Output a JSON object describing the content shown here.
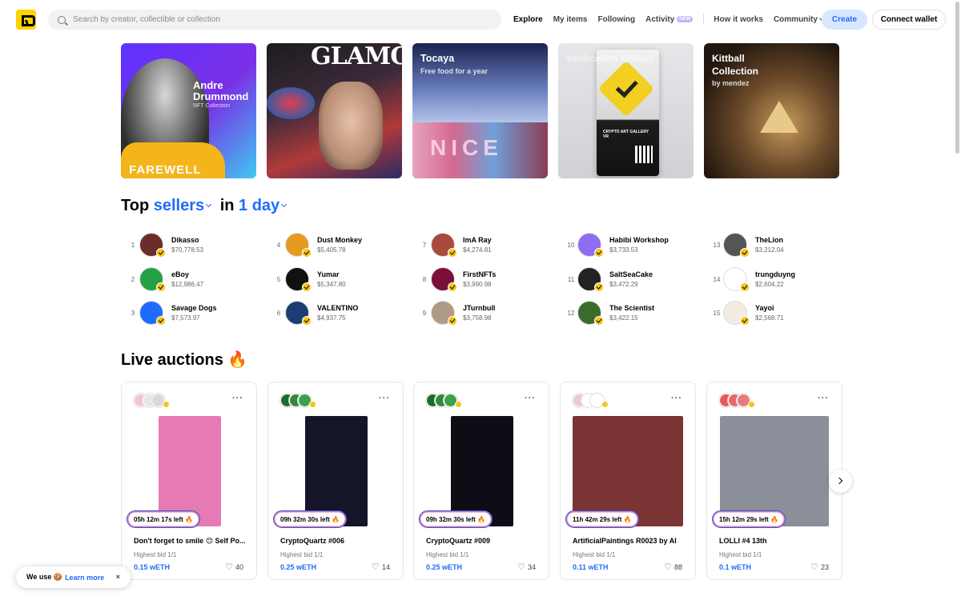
{
  "search": {
    "placeholder": "Search by creator, collectible or collection"
  },
  "nav": {
    "explore": "Explore",
    "my_items": "My items",
    "following": "Following",
    "activity": "Activity",
    "activity_badge": "NEW",
    "how_it_works": "How it works",
    "community": "Community"
  },
  "buttons": {
    "create": "Create",
    "connect_wallet": "Connect wallet"
  },
  "banners": [
    {
      "title_line1": "Andre",
      "title_line2": "Drummond",
      "subtitle": "NFT Collection",
      "text": "FAREWELL"
    },
    {
      "title": "GLAMOUR"
    },
    {
      "title": "Tocaya",
      "subtitle": "Free food for a year",
      "text": "NICE"
    },
    {
      "title": "Verification Collect",
      "text": "CRYPTO ART GALLERY VR"
    },
    {
      "title_line1": "Kittball",
      "title_line2": "Collection",
      "subtitle": "by mendez"
    }
  ],
  "top_sellers": {
    "title_prefix": "Top",
    "title_type": "sellers",
    "title_in": "in",
    "title_period": "1 day",
    "items": [
      {
        "rank": "1",
        "name": "Dikasso",
        "amount": "$70,778.53",
        "color": "#6b2c2c"
      },
      {
        "rank": "2",
        "name": "eBoy",
        "amount": "$12,986.47",
        "color": "#24a146"
      },
      {
        "rank": "3",
        "name": "Savage Dogs",
        "amount": "$7,573.97",
        "color": "#1f6bff"
      },
      {
        "rank": "4",
        "name": "Dust Monkey",
        "amount": "$5,405.78",
        "color": "#e79a22"
      },
      {
        "rank": "5",
        "name": "Yumar",
        "amount": "$5,347.80",
        "color": "#111111"
      },
      {
        "rank": "6",
        "name": "VALENTINO",
        "amount": "$4,937.75",
        "color": "#1b3d73"
      },
      {
        "rank": "7",
        "name": "ImA Ray",
        "amount": "$4,274.81",
        "color": "#a84a3c"
      },
      {
        "rank": "8",
        "name": "FirstNFTs",
        "amount": "$3,990.98",
        "color": "#7a0f3a"
      },
      {
        "rank": "9",
        "name": "JTurnbull",
        "amount": "$3,758.98",
        "color": "#b09a84"
      },
      {
        "rank": "10",
        "name": "Habibi Workshop",
        "amount": "$3,733.53",
        "color": "#8f6df2"
      },
      {
        "rank": "11",
        "name": "SaltSeaCake",
        "amount": "$3,472.29",
        "color": "#222222"
      },
      {
        "rank": "12",
        "name": "The Scientist",
        "amount": "$3,422.15",
        "color": "#3a6b2a"
      },
      {
        "rank": "13",
        "name": "TheLion",
        "amount": "$3,212.04",
        "color": "#555555"
      },
      {
        "rank": "14",
        "name": "trungduyng",
        "amount": "$2,604.22",
        "color": "#ffffff"
      },
      {
        "rank": "15",
        "name": "Yayoi",
        "amount": "$2,568.71",
        "color": "#f3ece2"
      }
    ]
  },
  "live_auctions": {
    "title": "Live auctions 🔥",
    "items": [
      {
        "timer": "05h  12m  17s  left 🔥",
        "name": "Don't forget to smile 😊 Self Po...",
        "bid_label": "Highest bid  1/1",
        "price": "0.15 wETH",
        "likes": "40",
        "art_color": "#e57ab4"
      },
      {
        "timer": "09h 32m 30s  left 🔥",
        "name": "CryptoQuartz #006",
        "bid_label": "Highest bid  1/1",
        "price": "0.25 wETH",
        "likes": "14",
        "art_color": "#15152a"
      },
      {
        "timer": "09h 32m 30s  left 🔥",
        "name": "CryptoQuartz #009",
        "bid_label": "Highest bid  1/1",
        "price": "0.25 wETH",
        "likes": "34",
        "art_color": "#0d0d16"
      },
      {
        "timer": "11h  42m  29s  left 🔥",
        "name": "ArtificialPaintings R0023 by AI",
        "bid_label": "Highest bid  1/1",
        "price": "0.11 wETH",
        "likes": "88",
        "art_color": "#7a3434"
      },
      {
        "timer": "15h  12m  29s  left 🔥",
        "name": "LOLLI #4 13th",
        "bid_label": "Highest bid  1/1",
        "price": "0.1 wETH",
        "likes": "23",
        "art_color": "#8a8f9a"
      }
    ]
  },
  "cookie": {
    "text": "We use 🍪",
    "link": "Learn more",
    "close": "×"
  },
  "colors": {
    "accent": "#1f6bff",
    "brand": "#FFD300",
    "verified": "#f5c518"
  }
}
